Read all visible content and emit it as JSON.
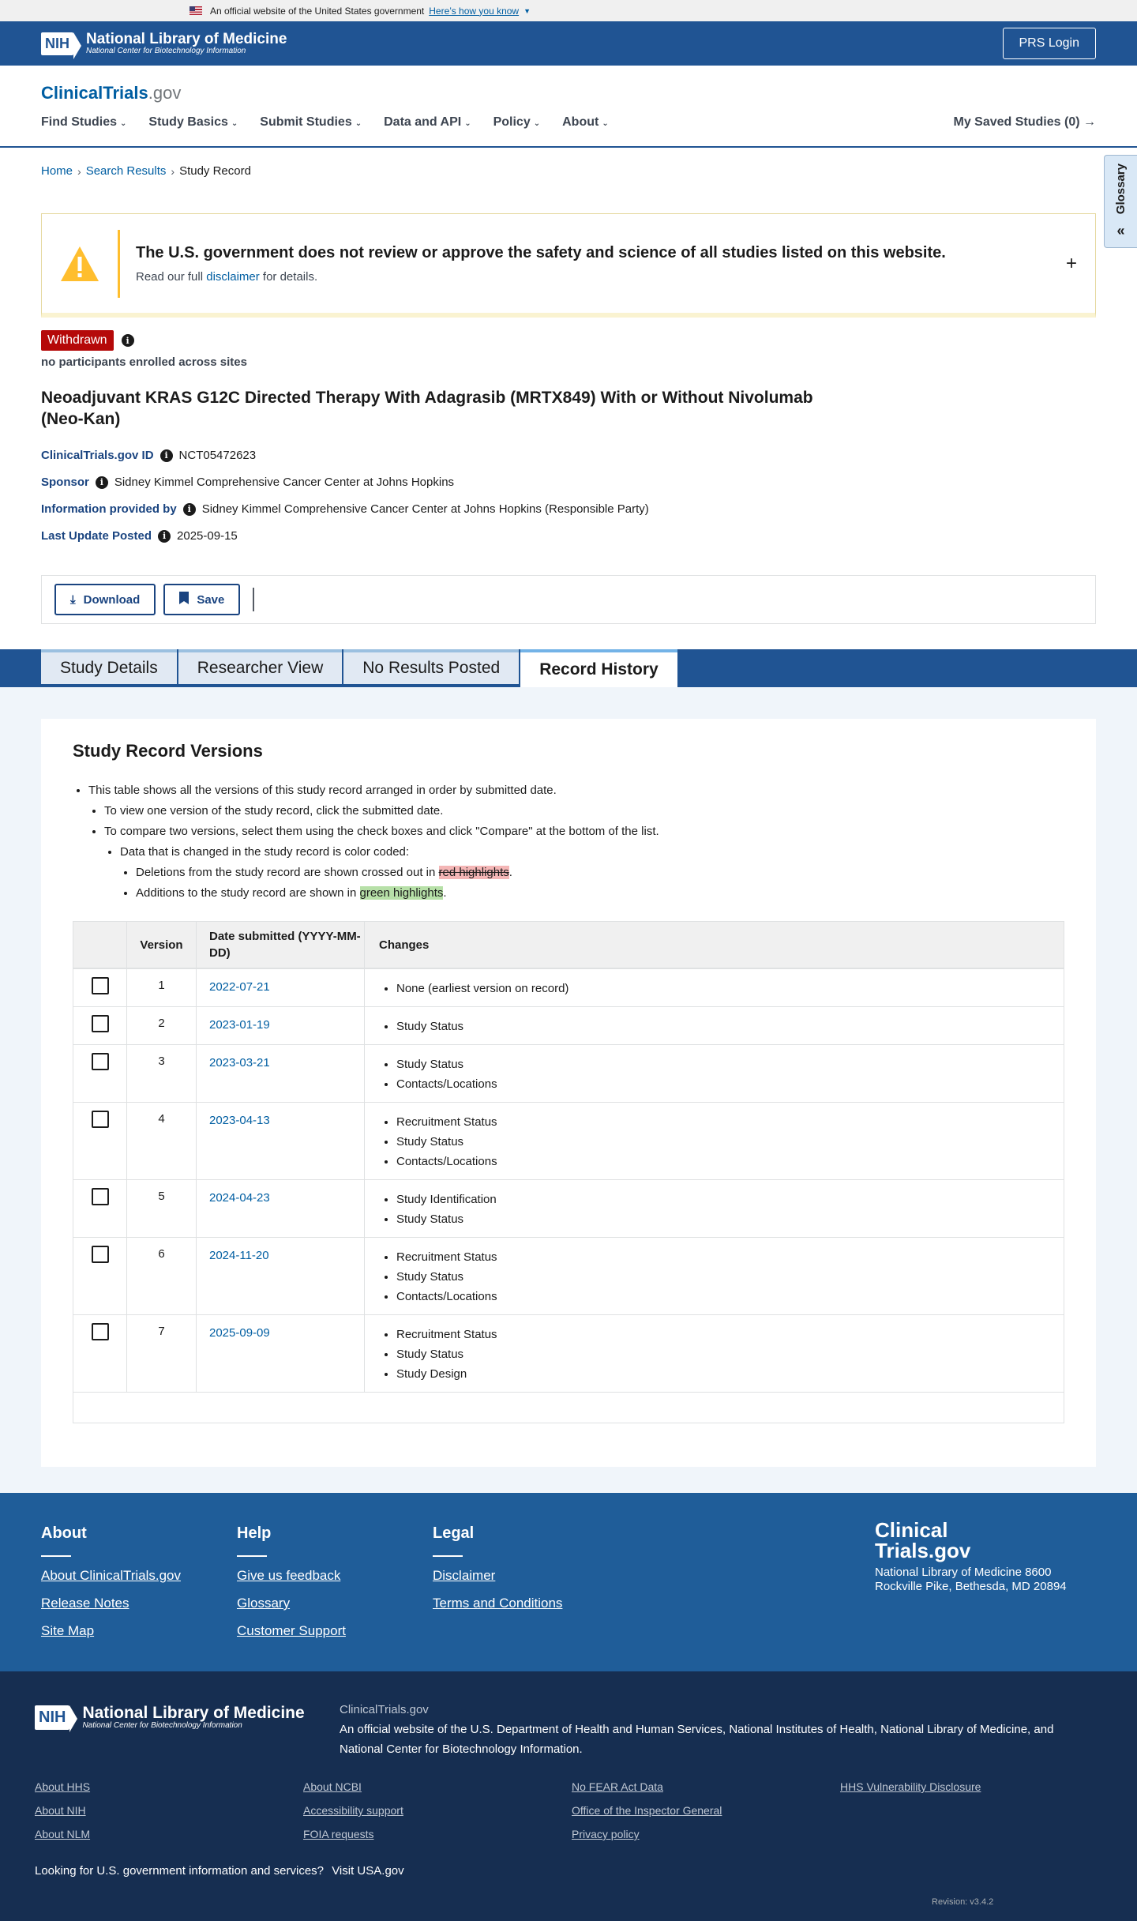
{
  "gov_banner": {
    "text": "An official website of the United States government",
    "link": "Here’s how you know"
  },
  "nlm": {
    "nih": "NIH",
    "title": "National Library of Medicine",
    "subtitle": "National Center for Biotechnology Information",
    "prs_login": "PRS Login"
  },
  "ct": {
    "logo_main": "ClinicalTrials",
    "logo_gov": ".gov"
  },
  "nav": {
    "items": [
      "Find Studies",
      "Study Basics",
      "Submit Studies",
      "Data and API",
      "Policy",
      "About"
    ],
    "saved": "My Saved Studies (0)"
  },
  "glossary": {
    "label": "Glossary"
  },
  "breadcrumb": {
    "home": "Home",
    "search": "Search Results",
    "current": "Study Record"
  },
  "alert": {
    "heading": "The U.S. government does not review or approve the safety and science of all studies listed on this website.",
    "pre": "Read our full",
    "link": "disclaimer",
    "post": "for details."
  },
  "study": {
    "status": "Withdrawn",
    "enrollment": "no participants enrolled across sites",
    "title": "Neoadjuvant KRAS G12C Directed Therapy With Adagrasib (MRTX849) With or Without Nivolumab (Neo-Kan)",
    "id_label": "ClinicalTrials.gov ID",
    "id": "NCT05472623",
    "sponsor_label": "Sponsor",
    "sponsor": "Sidney Kimmel Comprehensive Cancer Center at Johns Hopkins",
    "info_label": "Information provided by",
    "info": "Sidney Kimmel Comprehensive Cancer Center at Johns Hopkins (Responsible Party)",
    "update_label": "Last Update Posted",
    "update": "2025-09-15"
  },
  "actions": {
    "download": "Download",
    "save": "Save"
  },
  "tabs": [
    "Study Details",
    "Researcher View",
    "No Results Posted",
    "Record History"
  ],
  "history": {
    "heading": "Study Record Versions",
    "note1": "This table shows all the versions of this study record arranged in order by submitted date.",
    "note2": "To view one version of the study record, click the submitted date.",
    "note3": "To compare two versions, select them using the check boxes and click \"Compare\" at the bottom of the list.",
    "note4": "Data that is changed in the study record is color coded:",
    "note5_pre": "Deletions from the study record are shown crossed out in",
    "note5_hl": "red highlights",
    "note6_pre": "Additions to the study record are shown in",
    "note6_hl": "green highlights",
    "col_version": "Version",
    "col_date": "Date submitted (YYYY-MM-DD)",
    "col_changes": "Changes",
    "rows": [
      {
        "version": "1",
        "date": "2022-07-21",
        "changes": [
          "None (earliest version on record)"
        ]
      },
      {
        "version": "2",
        "date": "2023-01-19",
        "changes": [
          "Study Status"
        ]
      },
      {
        "version": "3",
        "date": "2023-03-21",
        "changes": [
          "Study Status",
          "Contacts/Locations"
        ]
      },
      {
        "version": "4",
        "date": "2023-04-13",
        "changes": [
          "Recruitment Status",
          "Study Status",
          "Contacts/Locations"
        ]
      },
      {
        "version": "5",
        "date": "2024-04-23",
        "changes": [
          "Study Identification",
          "Study Status"
        ]
      },
      {
        "version": "6",
        "date": "2024-11-20",
        "changes": [
          "Recruitment Status",
          "Study Status",
          "Contacts/Locations"
        ]
      },
      {
        "version": "7",
        "date": "2025-09-09",
        "changes": [
          "Recruitment Status",
          "Study Status",
          "Study Design"
        ]
      }
    ]
  },
  "footer": {
    "about": {
      "heading": "About",
      "links": [
        "About ClinicalTrials.gov",
        "Release Notes",
        "Site Map"
      ]
    },
    "help": {
      "heading": "Help",
      "links": [
        "Give us feedback",
        "Glossary",
        "Customer Support"
      ]
    },
    "legal": {
      "heading": "Legal",
      "links": [
        "Disclaimer",
        "Terms and Conditions"
      ]
    },
    "brand_line1": "Clinical",
    "brand_line2": "Trials.gov",
    "address": "National Library of Medicine 8600 Rockville Pike, Bethesda, MD 20894"
  },
  "footer_bottom": {
    "site": "ClinicalTrials.gov",
    "pre": "An official website of the",
    "hhs": "U.S. Department of Health and Human Services",
    "nih": "National Institutes of Health",
    "nlm": "National Library of Medicine",
    "and": "and",
    "ncbi": "National Center for Biotechnology Information",
    "links_col1": [
      "About HHS",
      "About NIH",
      "About NLM"
    ],
    "links_col2": [
      "About NCBI",
      "Accessibility support",
      "FOIA requests"
    ],
    "links_col3": [
      "No FEAR Act Data",
      "Office of the Inspector General",
      "Privacy policy"
    ],
    "links_col4": [
      "HHS Vulnerability Disclosure"
    ],
    "usa_text": "Looking for U.S. government information and services?",
    "usa_link": "Visit USA.gov",
    "revision": "Revision: v3.4.2"
  }
}
